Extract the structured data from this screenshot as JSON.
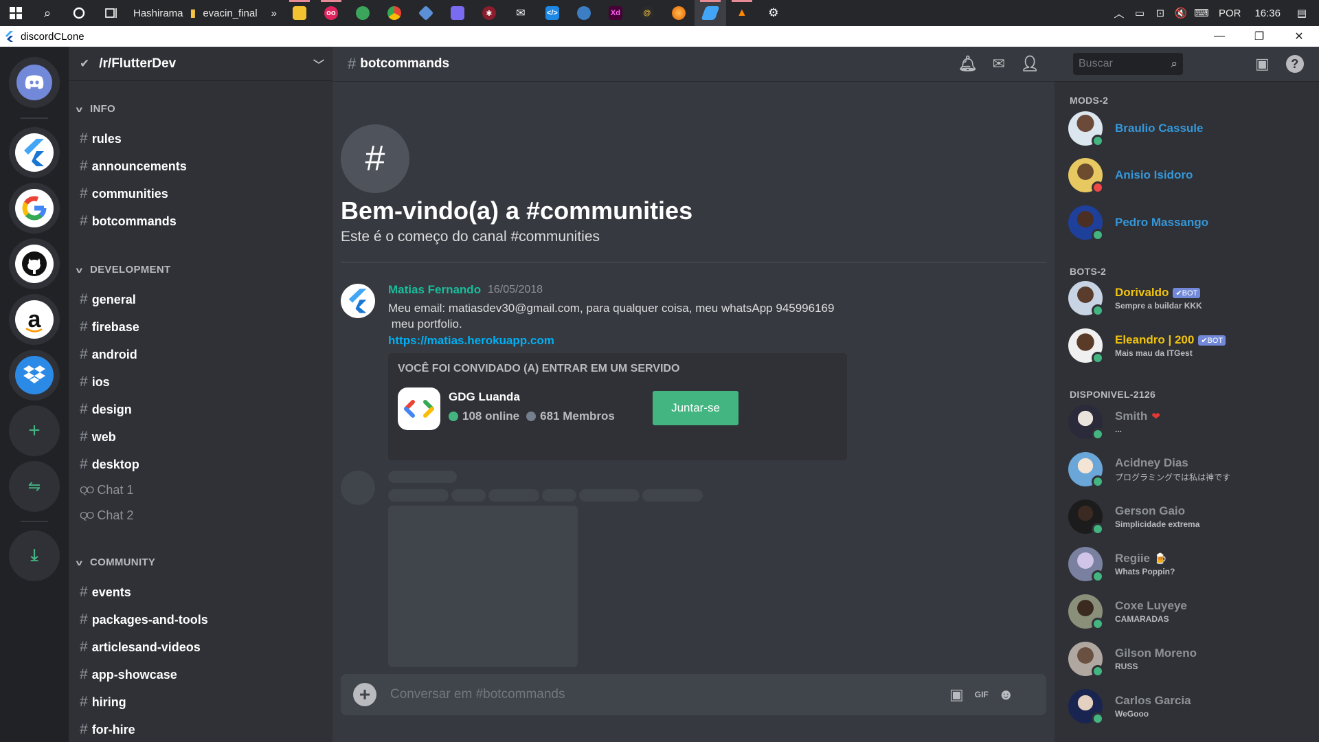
{
  "taskbar": {
    "items": [
      "Hashirama",
      "evacin_final"
    ],
    "more": "»",
    "lang": "POR",
    "time": "16:36"
  },
  "window": {
    "title": "discordCLone",
    "minimize": "—",
    "maximize": "❐",
    "close": "✕"
  },
  "guild": {
    "name": "/r/FlutterDev",
    "categories": {
      "info": "INFO",
      "development": "DEVELOPMENT",
      "community": "COMMUNITY"
    },
    "info_channels": [
      "rules",
      "announcements",
      "communities",
      "botcommands"
    ],
    "dev_channels": [
      "general",
      "firebase",
      "android",
      "ios",
      "design",
      "web",
      "desktop"
    ],
    "voice_channels": [
      "Chat 1",
      "Chat 2"
    ],
    "community_channels": [
      "events",
      "packages-and-tools",
      "articlesand-videos",
      "app-showcase",
      "hiring",
      "for-hire"
    ]
  },
  "chat": {
    "channel": "botcommands",
    "welcome_title": "Bem-vindo(a) a #communities",
    "welcome_sub": "Este é o começo do canal #communities",
    "message": {
      "author": "Matias Fernando",
      "date": "16/05/2018",
      "line1": "Meu email: matiasdev30@gmail.com, para qualquer coisa, meu whatsApp 945996169",
      "line2": " meu portfolio.",
      "link": "https://matias.herokuapp.com"
    },
    "invite": {
      "title": "VOCÊ FOI CONVIDADO (A) ENTRAR EM UM SERVIDO",
      "server": "GDG Luanda",
      "online": "108 online",
      "members": "681 Membros",
      "button": "Juntar-se"
    },
    "composer_placeholder": "Conversar em #botcommands",
    "gif_label": "GIF"
  },
  "members": {
    "search_placeholder": "Buscar",
    "groups": [
      {
        "title": "MODS-2"
      },
      {
        "title": "BOTS-2"
      },
      {
        "title": "DISPONIVEL-2126"
      }
    ],
    "mods": [
      {
        "name": "Braulio Cassule",
        "status": "online"
      },
      {
        "name": "Anisio Isidoro",
        "status": "dnd"
      },
      {
        "name": "Pedro Massango",
        "status": "online"
      }
    ],
    "bots": [
      {
        "name": "Dorivaldo",
        "badge": "✔BOT",
        "sub": "Sempre a buildar KKK"
      },
      {
        "name": "Eleandro | 200",
        "badge": "✔BOT",
        "sub": "Mais mau da ITGest"
      }
    ],
    "available": [
      {
        "name": "Smith",
        "sub": "...",
        "emoji": "❤"
      },
      {
        "name": "Acidney Dias",
        "sub": "プログラミングでは私は神です"
      },
      {
        "name": "Gerson Gaio",
        "sub": "Simplicidade extrema"
      },
      {
        "name": "Regiie",
        "sub": "Whats Poppin?",
        "emoji": "🍺"
      },
      {
        "name": "Coxe Luyeye",
        "sub": "CAMARADAS"
      },
      {
        "name": "Gilson Moreno",
        "sub": "RUSS"
      },
      {
        "name": "Carlos Garcia",
        "sub": "WeGooo"
      }
    ]
  },
  "colors": {
    "mod_name": "#3498db",
    "bot_name": "#f1c40f",
    "online": "#43b581",
    "dnd": "#f04747",
    "author": "#1abc9c",
    "link": "#00b0f4"
  }
}
